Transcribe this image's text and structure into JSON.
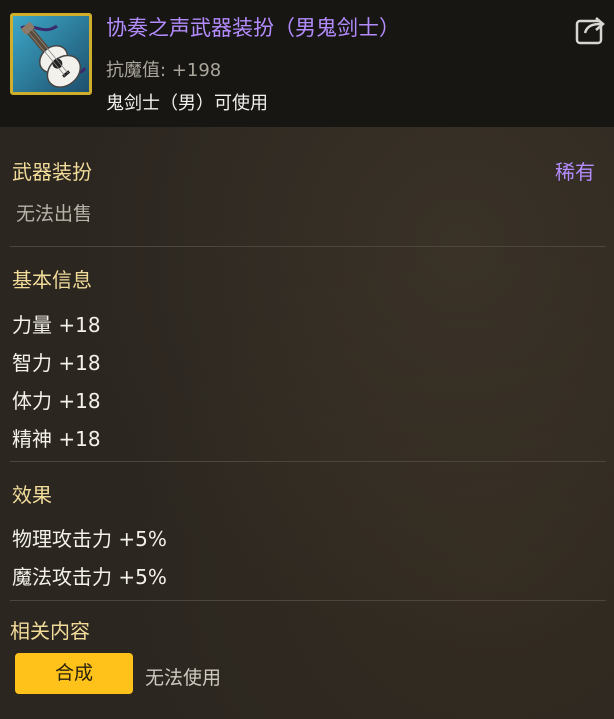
{
  "item": {
    "title": "协奏之声武器装扮（男鬼剑士）",
    "stat": "抗魔值: +198",
    "restriction": "鬼剑士（男）可使用",
    "icon": "guitar-icon",
    "share_icon": "share-icon"
  },
  "category": {
    "label": "武器装扮",
    "rarity": "稀有",
    "trade_status": "无法出售"
  },
  "basic_info": {
    "title": "基本信息",
    "stats": [
      "力量 +18",
      "智力 +18",
      "体力 +18",
      "精神 +18"
    ]
  },
  "effects": {
    "title": "效果",
    "lines": [
      "物理攻击力 +5%",
      "魔法攻击力 +5%"
    ]
  },
  "related": {
    "title": "相关内容",
    "compose_label": "合成",
    "status": "无法使用"
  },
  "colors": {
    "rarity": "#b48cff",
    "section_title": "#f2dc9a",
    "button": "#ffc21a",
    "icon_border": "#cfae2c"
  }
}
